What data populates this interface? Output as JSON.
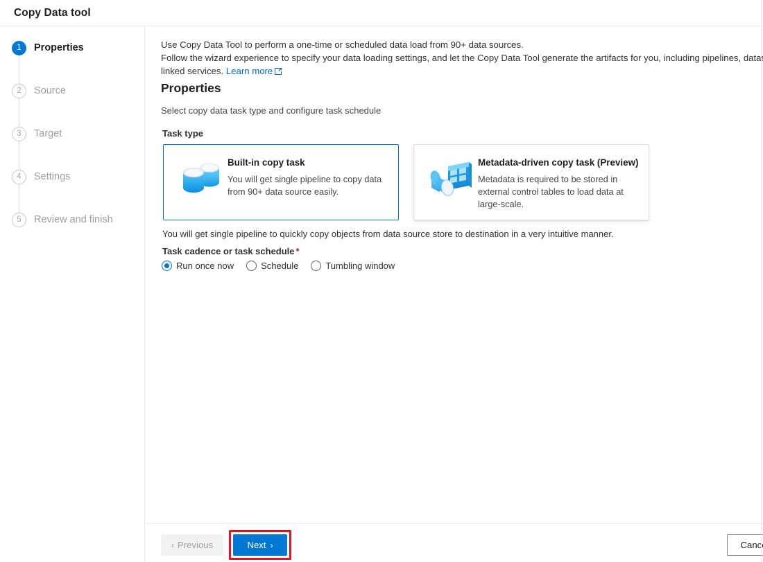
{
  "window": {
    "title": "Copy Data tool"
  },
  "sidebar": {
    "steps": [
      {
        "number": "1",
        "label": "Properties",
        "state": "active"
      },
      {
        "number": "2",
        "label": "Source",
        "state": "inactive"
      },
      {
        "number": "3",
        "label": "Target",
        "state": "inactive"
      },
      {
        "number": "4",
        "label": "Settings",
        "state": "inactive"
      },
      {
        "number": "5",
        "label": "Review and finish",
        "state": "inactive"
      }
    ]
  },
  "main": {
    "intro": {
      "line1": "Use Copy Data Tool to perform a one-time or scheduled data load from 90+ data sources.",
      "line2": "Follow the wizard experience to specify your data loading settings, and let the Copy Data Tool generate the artifacts for you, including pipelines, datasets, and",
      "line3_prefix": "linked services.",
      "link_label": "Learn more",
      "link_icon": "external-link-icon"
    },
    "section_title": "Properties",
    "section_subtitle": "Select copy data task type and configure task schedule",
    "task_type_label": "Task type",
    "cards": [
      {
        "id": "built-in-copy-task",
        "title": "Built-in copy task",
        "description": "You will get single pipeline to copy data from 90+ data source easily.",
        "icon": "database-stack-icon",
        "selected": true
      },
      {
        "id": "metadata-driven-copy-task",
        "title": "Metadata-driven copy task (Preview)",
        "description": "Metadata is required to be stored in external control tables to load data at large-scale.",
        "icon": "metadata-table-funnel-icon",
        "selected": false
      }
    ],
    "selection_note": "You will get single pipeline to quickly copy objects from data source store to destination in a very intuitive manner.",
    "cadence": {
      "label": "Task cadence or task schedule",
      "required_marker": "*",
      "options": [
        {
          "id": "run-once-now",
          "label": "Run once now",
          "checked": true
        },
        {
          "id": "schedule",
          "label": "Schedule",
          "checked": false
        },
        {
          "id": "tumbling-window",
          "label": "Tumbling window",
          "checked": false
        }
      ]
    }
  },
  "footer": {
    "previous_label": "Previous",
    "previous_chevron": "‹",
    "next_label": "Next",
    "next_chevron": "›",
    "cancel_label": "Cancel"
  },
  "colors": {
    "accent": "#0078d4",
    "link": "#0066cc",
    "annotation": "#e81123",
    "required": "#a4262c",
    "disabled_text": "#a19f9d"
  }
}
